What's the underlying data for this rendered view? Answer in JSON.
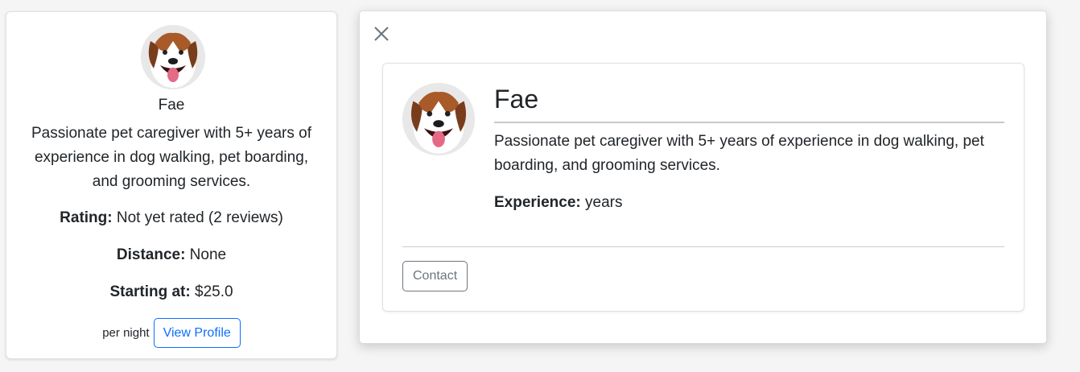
{
  "left_card": {
    "name": "Fae",
    "bio": "Passionate pet caregiver with 5+ years of experience in dog walking, pet boarding, and grooming services.",
    "rating_label": "Rating:",
    "rating_value": " Not yet rated (2 reviews)",
    "distance_label": "Distance:",
    "distance_value": " None",
    "price_label": "Starting at:",
    "price_value": " $25.0",
    "per_night": "per night",
    "view_profile": "View Profile"
  },
  "modal": {
    "close_icon": "close-icon",
    "name": "Fae",
    "bio": "Passionate pet caregiver with 5+ years of experience in dog walking, pet boarding, and grooming services.",
    "experience_label": "Experience:",
    "experience_value": " years",
    "contact_label": "Contact"
  },
  "colors": {
    "primary": "#0d6efd",
    "secondary": "#6c757d"
  }
}
